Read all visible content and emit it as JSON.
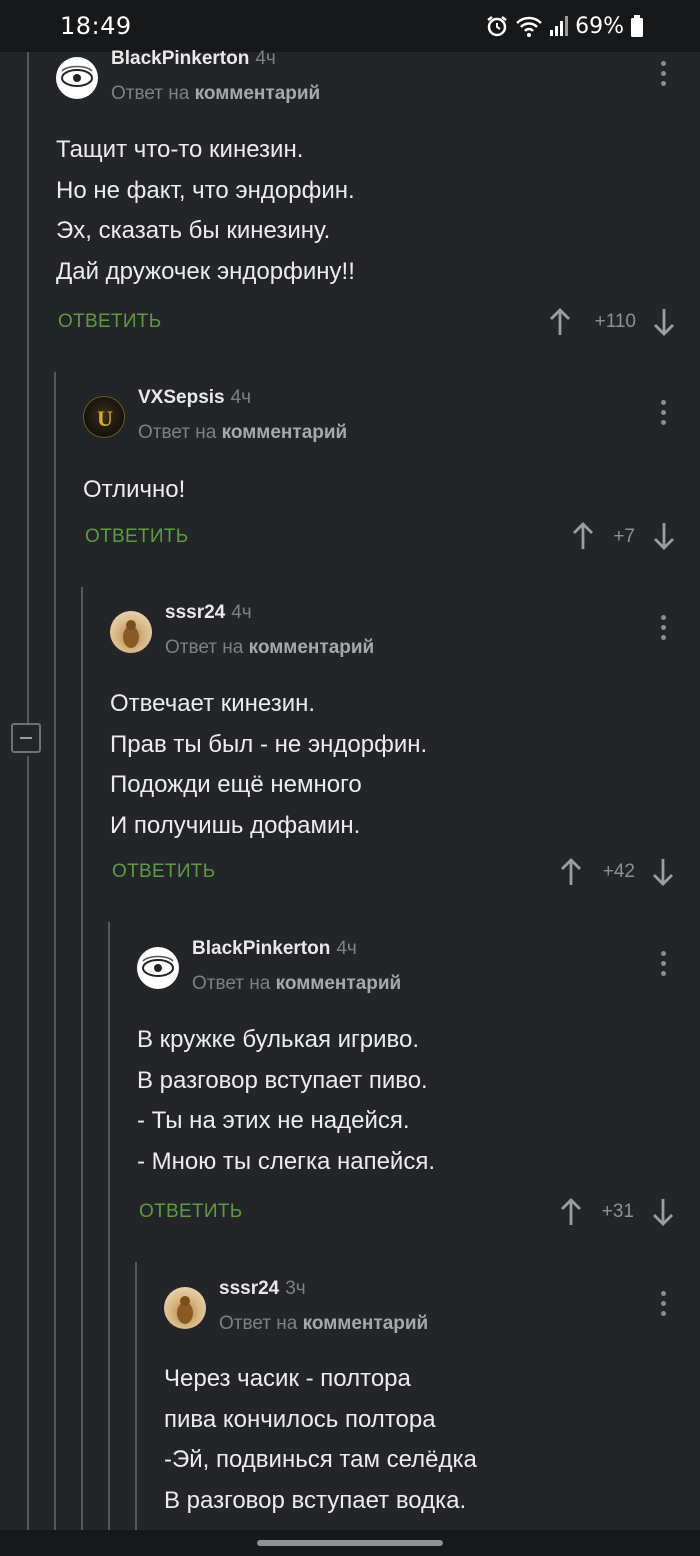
{
  "status_bar": {
    "time": "18:49",
    "battery": "69%",
    "icons": [
      "alarm-icon",
      "wifi-icon",
      "signal-icon",
      "battery-icon"
    ]
  },
  "reply_to_prefix": "Ответ на",
  "reply_to_target": "комментарий",
  "reply_label": "ОТВЕТИТЬ",
  "comments": [
    {
      "author": "BlackPinkerton",
      "time": "4ч",
      "lines": [
        "Тащит что-то кинезин.",
        "Но не факт, что эндорфин.",
        "Эх, сказать бы кинезину.",
        "Дай дружочек эндорфину!!"
      ],
      "rating": "+110"
    },
    {
      "author": "VXSepsis",
      "time": "4ч",
      "lines": [
        "Отлично!"
      ],
      "rating": "+7"
    },
    {
      "author": "sssr24",
      "time": "4ч",
      "lines": [
        "Отвечает кинезин.",
        "Прав ты был - не эндорфин.",
        "Подожди ещё немного",
        "И получишь дофамин."
      ],
      "rating": "+42"
    },
    {
      "author": "BlackPinkerton",
      "time": "4ч",
      "lines": [
        "В кружке булькая игриво.",
        "В разговор вступает пиво.",
        "- Ты на этих не надейся.",
        "- Мною ты слегка напейся."
      ],
      "rating": "+31"
    },
    {
      "author": "sssr24",
      "time": "3ч",
      "lines": [
        "Через часик - полтора",
        "пива кончилось полтора",
        "-Эй, подвинься там селёдка",
        "В разговор вступает водка."
      ]
    }
  ],
  "colors": {
    "background": "#232529",
    "accent_green": "#5e9a42",
    "muted": "#7d8085"
  }
}
